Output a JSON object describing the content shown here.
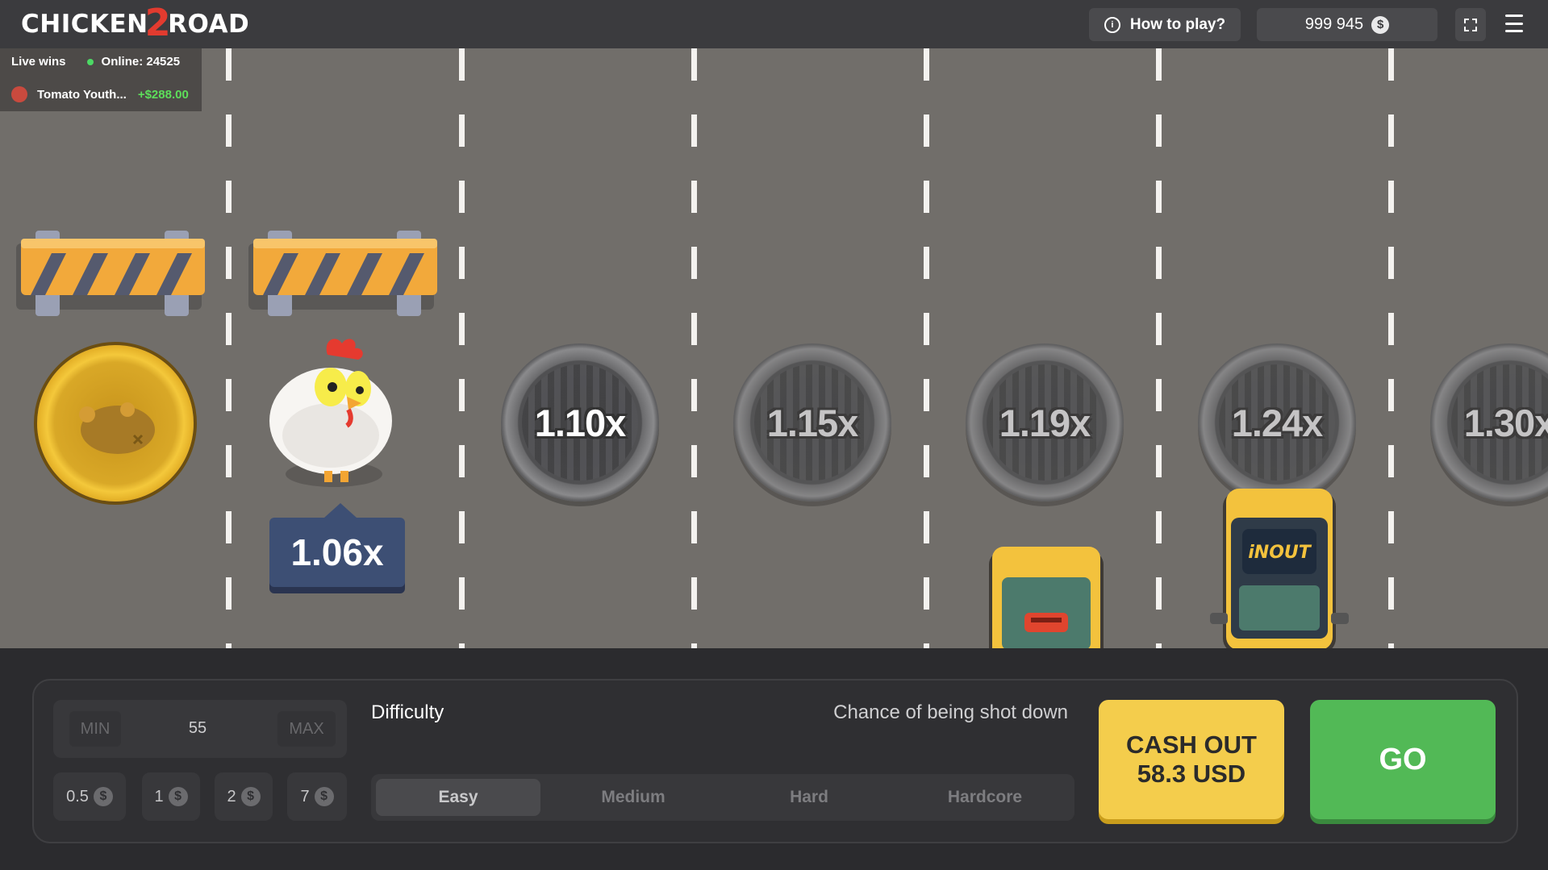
{
  "header": {
    "logo_left": "CHICKEN",
    "logo_digit": "2",
    "logo_right": "ROAD",
    "how_to_label": "How to play?",
    "balance": "999 945",
    "currency_symbol": "$"
  },
  "live": {
    "title": "Live wins",
    "online": "Online: 24525",
    "entries": [
      {
        "player": "Tomato Youth...",
        "amount": "+$288.00"
      }
    ]
  },
  "board": {
    "current_multiplier": "1.06x",
    "multipliers": [
      "1.10x",
      "1.15x",
      "1.19x",
      "1.24x",
      "1.30x"
    ],
    "car_logo_text": "iNOUT"
  },
  "controls": {
    "bet": {
      "min_label": "MIN",
      "value": "55",
      "max_label": "MAX"
    },
    "quick_bets": [
      "0.5",
      "1",
      "2",
      "7"
    ],
    "difficulty_label": "Difficulty",
    "chance_label": "Chance of being shot down",
    "difficulties": [
      "Easy",
      "Medium",
      "Hard",
      "Hardcore"
    ],
    "selected_difficulty": "Easy",
    "cashout_title": "CASH OUT",
    "cashout_amount": "58.3 USD",
    "go_label": "GO"
  },
  "colors": {
    "road": "#716e6a",
    "cashout": "#f4cd4c",
    "go": "#52b956",
    "win_amount": "#5dde5a",
    "multiplier_tag": "#3d4f74"
  }
}
